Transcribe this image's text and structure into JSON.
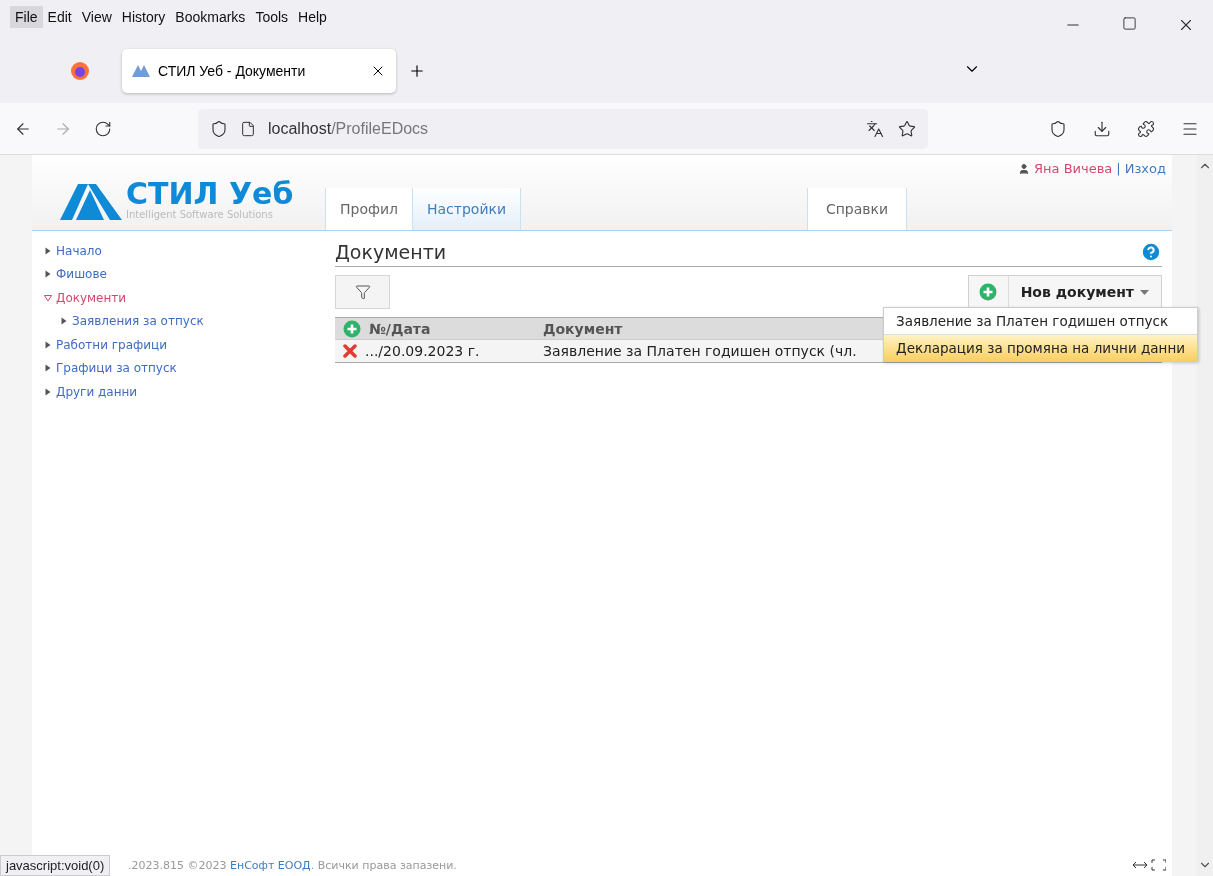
{
  "menu_bar": [
    {
      "label": "File",
      "selected": true
    },
    {
      "label": "Edit",
      "selected": false
    },
    {
      "label": "View",
      "selected": false
    },
    {
      "label": "History",
      "selected": false
    },
    {
      "label": "Bookmarks",
      "selected": false
    },
    {
      "label": "Tools",
      "selected": false
    },
    {
      "label": "Help",
      "selected": false
    }
  ],
  "browser_tab": {
    "title": "СТИЛ Уеб - Документи"
  },
  "address_bar": {
    "host": "localhost",
    "path": "/ProfileEDocs"
  },
  "user": {
    "name": "Яна Вичева",
    "separator": "|",
    "logout": "Изход"
  },
  "logo": {
    "title": "СТИЛ Уеб",
    "tagline": "Intelligent Software Solutions"
  },
  "tabs": [
    {
      "label": "Профил",
      "selected": false
    },
    {
      "label": "Настройки",
      "selected": true
    }
  ],
  "tabs_right": [
    {
      "label": "Справки",
      "selected": false
    }
  ],
  "sidebar": {
    "items": [
      {
        "label": "Начало",
        "expanded": false,
        "selected": false
      },
      {
        "label": "Фишове",
        "expanded": false,
        "selected": false
      },
      {
        "label": "Документи",
        "expanded": true,
        "selected": true,
        "children": [
          {
            "label": "Заявления за отпуск",
            "expanded": false,
            "selected": false
          }
        ]
      },
      {
        "label": "Работни графици",
        "expanded": false,
        "selected": false
      },
      {
        "label": "Графици за отпуск",
        "expanded": false,
        "selected": false
      },
      {
        "label": "Други данни",
        "expanded": false,
        "selected": false
      }
    ]
  },
  "page_title": "Документи",
  "new_document": {
    "label": "Нов документ",
    "menu": [
      {
        "label": "Заявление за Платен годишен отпуск",
        "selected": false
      },
      {
        "label": "Декларация за промяна на лични данни",
        "selected": true
      }
    ]
  },
  "table": {
    "columns": [
      "№/Дата",
      "Документ"
    ],
    "rows": [
      {
        "number": ".../20.09.2023 г.",
        "document": "Заявление за Платен годишен отпуск (чл."
      }
    ]
  },
  "footer": {
    "prefix": ".2023.815 ©2023",
    "company": "ЕнСофт ЕООД",
    "suffix": ". Всички права запазени."
  },
  "status_link": "javascript:void(0)"
}
